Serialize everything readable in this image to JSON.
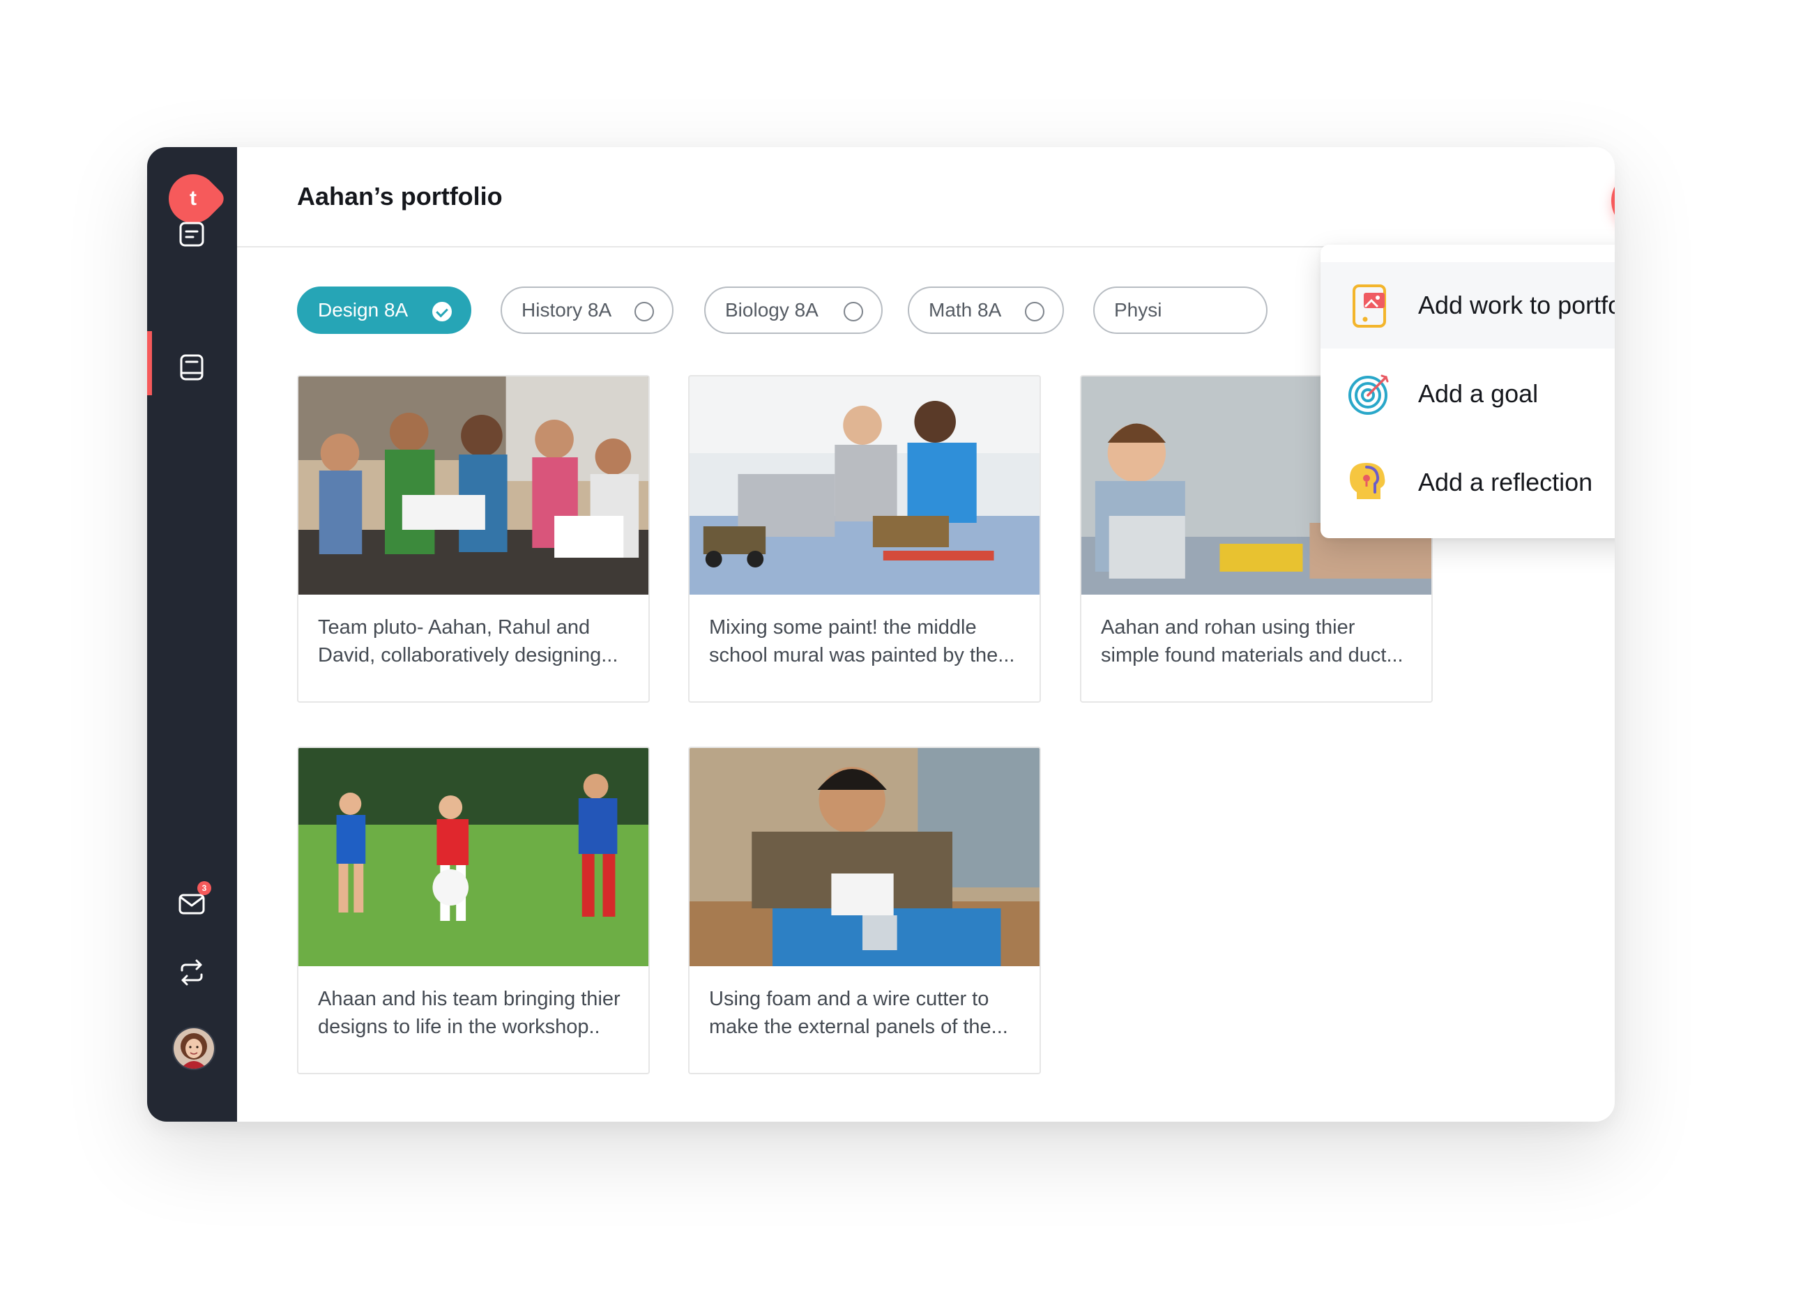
{
  "app": {
    "logo_letter": "t",
    "notification_count": "3"
  },
  "header": {
    "title": "Aahan’s portfolio"
  },
  "filters": [
    {
      "label": "Design 8A",
      "selected": true
    },
    {
      "label": "History 8A",
      "selected": false
    },
    {
      "label": "Biology 8A",
      "selected": false
    },
    {
      "label": "Math 8A",
      "selected": false
    },
    {
      "label": "Physi",
      "selected": false
    }
  ],
  "cards": [
    {
      "caption": "Team pluto- Aahan, Rahul and David, collaboratively designing..."
    },
    {
      "caption": "Mixing some paint! the middle school mural was painted by the..."
    },
    {
      "caption": "Aahan and rohan using thier simple found materials and duct..."
    },
    {
      "caption": "Ahaan and his team bringing thier designs to life in the workshop.."
    },
    {
      "caption": "Using foam and a wire cutter to make the external panels of the..."
    }
  ],
  "menu": {
    "items": [
      {
        "label": "Add work to portfolio",
        "icon": "portfolio-icon"
      },
      {
        "label": "Add a goal",
        "icon": "target-icon"
      },
      {
        "label": "Add a reflection",
        "icon": "reflection-head-icon"
      }
    ]
  },
  "colors": {
    "accent": "#f65a5b",
    "selected_chip": "#26a5b6",
    "sidebar": "#232833"
  }
}
